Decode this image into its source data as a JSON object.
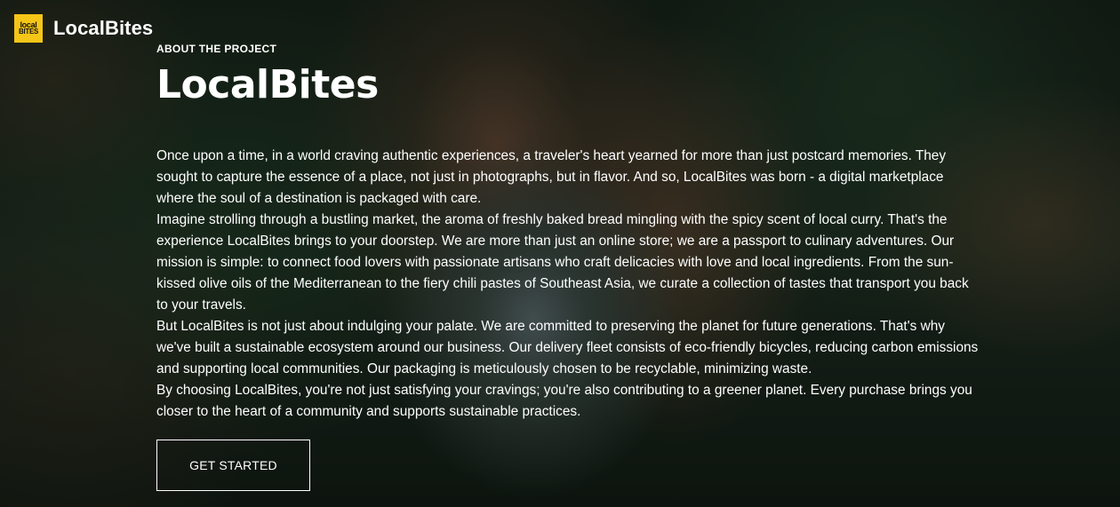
{
  "brand": {
    "logo_line1": "local",
    "logo_line2": "BITES",
    "name": "LocalBites"
  },
  "hero": {
    "eyebrow": "ABOUT THE PROJECT",
    "title": "LocalBites",
    "paragraphs": [
      "Once upon a time, in a world craving authentic experiences, a traveler's heart yearned for more than just postcard memories. They sought to capture the essence of a place, not just in photographs, but in flavor. And so, LocalBites was born - a digital marketplace where the soul of a destination is packaged with care.",
      "Imagine strolling through a bustling market, the aroma of freshly baked bread mingling with the spicy scent of local curry. That's the experience LocalBites brings to your doorstep. We are more than just an online store; we are a passport to culinary adventures. Our mission is simple: to connect food lovers with passionate artisans who craft delicacies with love and local ingredients. From the sun-kissed olive oils of the Mediterranean to the fiery chili pastes of Southeast Asia, we curate a collection of tastes that transport you back to your travels.",
      "But LocalBites is not just about indulging your palate. We are committed to preserving the planet for future generations. That's why we've built a sustainable ecosystem around our business. Our delivery fleet consists of eco-friendly bicycles, reducing carbon emissions and supporting local communities. Our packaging is meticulously chosen to be recyclable, minimizing waste.",
      "By choosing LocalBites, you're not just satisfying your cravings; you're also contributing to a greener planet. Every purchase brings you closer to the heart of a community and supports sustainable practices."
    ],
    "cta_label": "GET STARTED"
  },
  "colors": {
    "logo_bg": "#f5c518",
    "text": "#ffffff"
  }
}
